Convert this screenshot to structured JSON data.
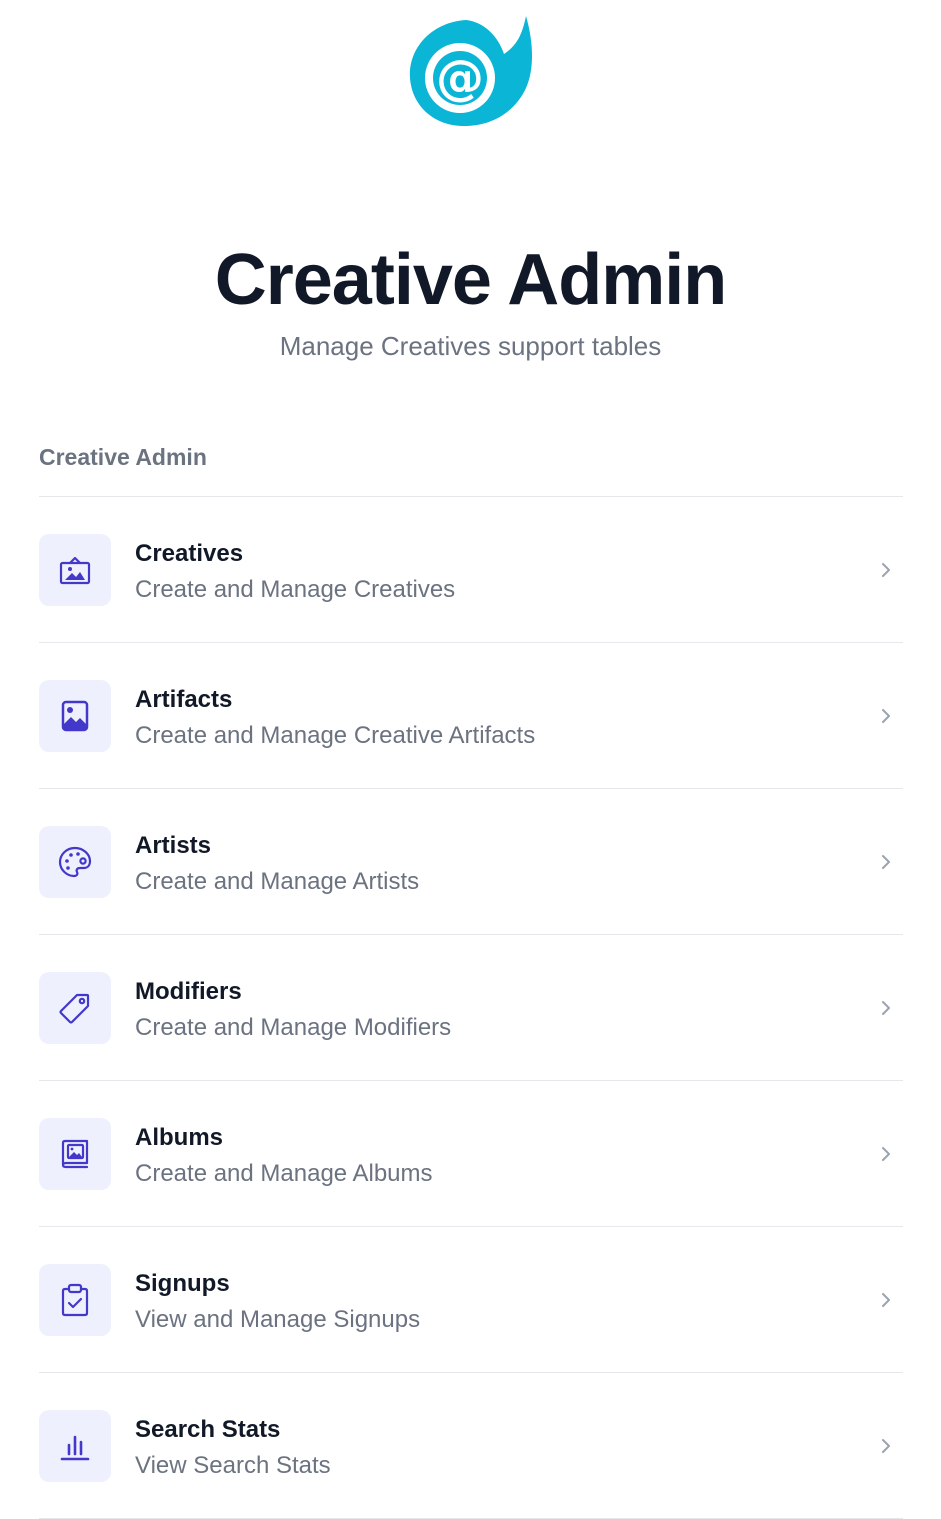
{
  "header": {
    "logo_icon": "blazor-logo-icon",
    "logo_color": "#0bb5d6",
    "title": "Creative Admin",
    "subtitle": "Manage Creatives support tables"
  },
  "section": {
    "label": "Creative Admin"
  },
  "accent_color": "#4f46e5",
  "items": [
    {
      "title": "Creatives",
      "description": "Create and Manage Creatives",
      "icon": "picture-frame-icon"
    },
    {
      "title": "Artifacts",
      "description": "Create and Manage Creative Artifacts",
      "icon": "image-icon"
    },
    {
      "title": "Artists",
      "description": "Create and Manage Artists",
      "icon": "palette-icon"
    },
    {
      "title": "Modifiers",
      "description": "Create and Manage Modifiers",
      "icon": "tag-icon"
    },
    {
      "title": "Albums",
      "description": "Create and Manage Albums",
      "icon": "photo-album-icon"
    },
    {
      "title": "Signups",
      "description": "View and Manage Signups",
      "icon": "clipboard-check-icon"
    },
    {
      "title": "Search Stats",
      "description": "View Search Stats",
      "icon": "bar-chart-icon"
    }
  ]
}
